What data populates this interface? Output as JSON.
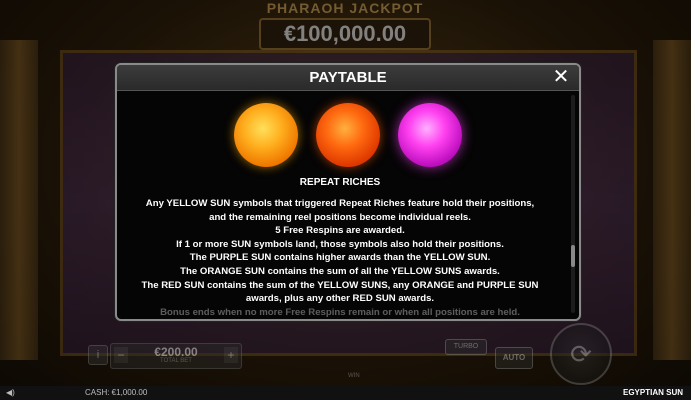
{
  "background": {
    "jackpot_title": "PHARAOH JACKPOT",
    "jackpot_value": "€100,000.00",
    "bet_value": "€200.00",
    "bet_label": "TOTAL BET",
    "autoplay_label": "AUTO",
    "turbo_label": "TURBO",
    "win_label": "WIN",
    "info_label": "i",
    "minus": "−",
    "plus": "+",
    "spin_glyph": "⟳"
  },
  "bottom_bar": {
    "sound_icon": "speaker-icon",
    "cash_text": "CASH: €1,000.00",
    "game_name": "EGYPTIAN SUN"
  },
  "modal": {
    "title": "PAYTABLE",
    "close_label": "✕",
    "symbols": [
      {
        "name": "yellow-sun",
        "color": "#ffb020"
      },
      {
        "name": "orange-sun",
        "color": "#ff6a10"
      },
      {
        "name": "purple-sun",
        "color": "#ff40f0"
      }
    ],
    "feature_title": "REPEAT RICHES",
    "lines": [
      "Any YELLOW SUN symbols that triggered Repeat Riches feature hold their positions,",
      "and the remaining reel positions become individual reels.",
      "5 Free Respins are awarded.",
      "If 1 or more SUN symbols land, those symbols also hold their positions.",
      "The PURPLE SUN contains higher awards than the YELLOW SUN.",
      "The ORANGE SUN contains the sum of all the YELLOW SUNS awards.",
      "The RED SUN contains the sum of the YELLOW SUNS, any ORANGE and PURPLE SUN",
      "awards, plus any other RED SUN awards.",
      "Bonus ends when no more Free Respins remain or when all positions are held."
    ]
  }
}
